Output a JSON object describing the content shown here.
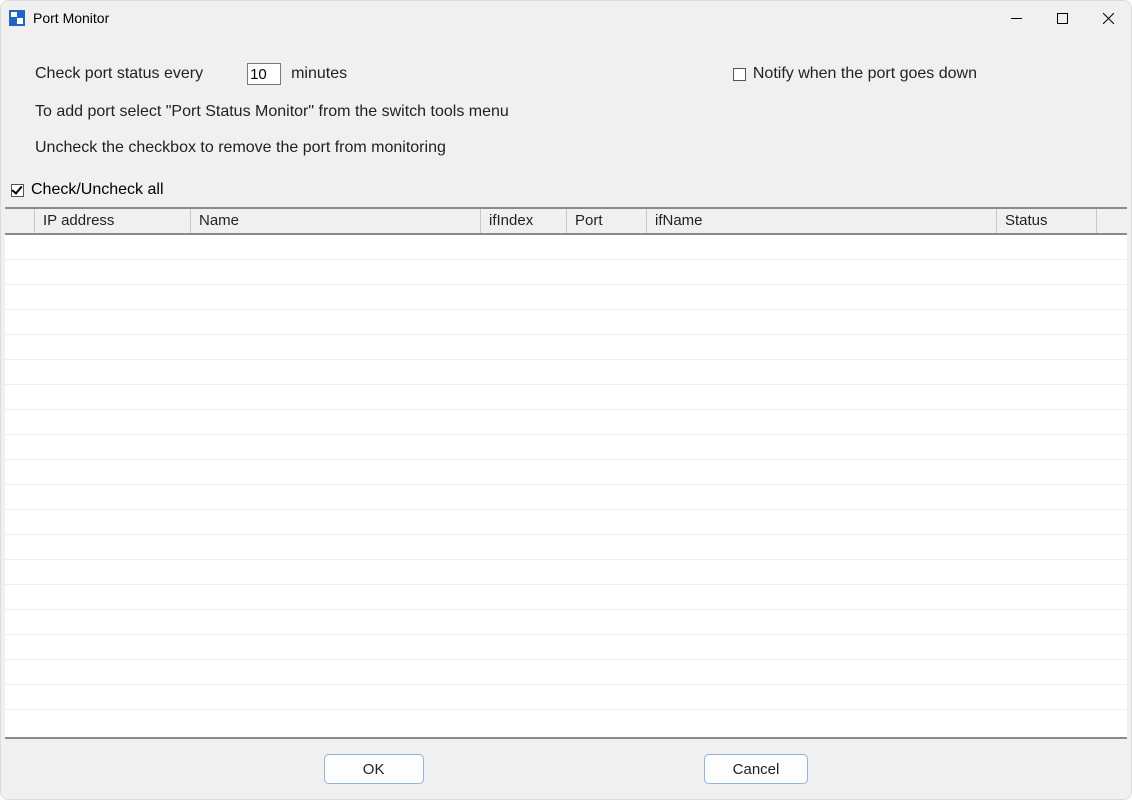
{
  "window": {
    "title": "Port Monitor"
  },
  "top": {
    "check_label": "Check port status every",
    "interval_value": "10",
    "minutes_label": "minutes",
    "notify_label": "Notify when the port goes down",
    "notify_checked": false,
    "instr1": "To add port select \"Port Status Monitor\" from the switch tools menu",
    "instr2": "Uncheck the checkbox to remove the port from monitoring"
  },
  "checkall": {
    "label": "Check/Uncheck all",
    "checked": true
  },
  "table": {
    "columns": {
      "ip": "IP address",
      "name": "Name",
      "ifindex": "ifIndex",
      "port": "Port",
      "ifname": "ifName",
      "status": "Status"
    },
    "rows": []
  },
  "buttons": {
    "ok": "OK",
    "cancel": "Cancel"
  }
}
